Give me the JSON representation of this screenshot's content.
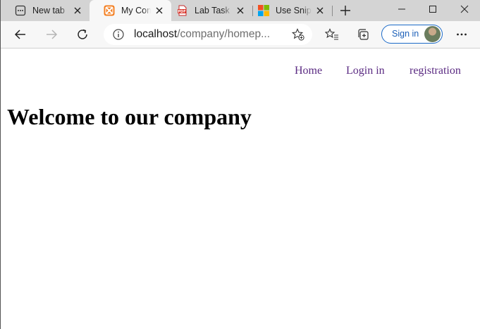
{
  "browser": {
    "tabs": [
      {
        "title": "New tab",
        "favicon": "new-tab-icon"
      },
      {
        "title": "My Company",
        "favicon": "xampp-icon",
        "active": true
      },
      {
        "title": "Lab Task",
        "favicon": "pdf-icon"
      },
      {
        "title": "Use Snipping Tool",
        "favicon": "microsoft-icon"
      }
    ],
    "address_bar": {
      "host": "localhost",
      "path": "/company/homep..."
    },
    "signin_label": "Sign in",
    "accent_color": "#1b6ac9"
  },
  "page": {
    "nav": {
      "home": "Home",
      "login": "Login in",
      "registration": "registration"
    },
    "heading": "Welcome to our company",
    "link_color": "#5a2a82"
  }
}
